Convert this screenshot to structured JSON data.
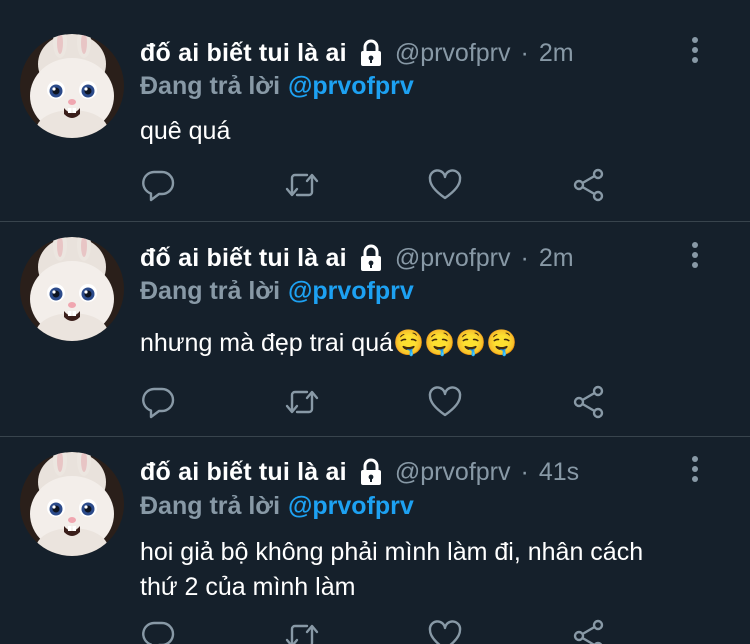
{
  "colors": {
    "background": "#15202b",
    "divider": "#38444d",
    "muted": "#8899a6",
    "accent": "#1da1f2",
    "text": "#ffffff"
  },
  "tweets": [
    {
      "name": "đố ai biết tui là ai",
      "handle": "@prvofprv",
      "separator": "·",
      "time": "2m",
      "reply_prefix": "Đang trả lời",
      "reply_to": "@prvofprv",
      "text": "quê quá",
      "icons": [
        "lock-icon",
        "more-vertical-icon",
        "reply-icon",
        "retweet-icon",
        "like-icon",
        "share-icon"
      ]
    },
    {
      "name": "đố ai biết tui là ai",
      "handle": "@prvofprv",
      "separator": "·",
      "time": "2m",
      "reply_prefix": "Đang trả lời",
      "reply_to": "@prvofprv",
      "text": "nhưng mà đẹp trai quá🤤🤤🤤🤤",
      "icons": [
        "lock-icon",
        "more-vertical-icon",
        "reply-icon",
        "retweet-icon",
        "like-icon",
        "share-icon"
      ]
    },
    {
      "name": "đố ai biết tui là ai",
      "handle": "@prvofprv",
      "separator": "·",
      "time": "41s",
      "reply_prefix": "Đang trả lời",
      "reply_to": "@prvofprv",
      "text": "hoi giả bộ không phải mình làm đi, nhân cách thứ 2 của mình làm",
      "icons": [
        "lock-icon",
        "more-vertical-icon",
        "reply-icon",
        "retweet-icon",
        "like-icon",
        "share-icon"
      ]
    }
  ]
}
